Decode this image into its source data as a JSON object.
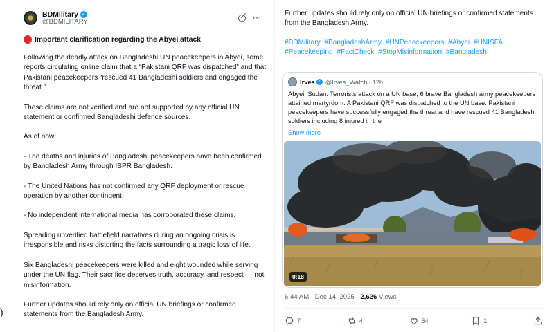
{
  "post": {
    "author": "BDMilitary",
    "handle": "@BDMILITARY",
    "headline": "Important clarification regarding the Abyei attack",
    "paragraphs": [
      "Following the deadly attack on Bangladeshi UN peacekeepers in Abyei, some reports circulating online claim that a “Pakistani QRF was dispatched” and that Pakistani peacekeepers “rescued 41 Bangladeshi soldiers and engaged the threat.”",
      "These claims are not verified and are not supported by any official UN statement or confirmed Bangladeshi defence sources.",
      "As of now:",
      "- The deaths and injuries of Bangladeshi peacekeepers have been confirmed by Bangladesh Army through ISPR Bangladesh.",
      "- The United Nations has not confirmed any QRF deployment or rescue operation by another contingent.",
      "- No independent international media has corroborated these claims.",
      "Spreading unverified battlefield narratives during an ongoing crisis is irresponsible and risks distorting the facts surrounding a tragic loss of life.",
      "Six Bangladeshi peacekeepers were killed and eight wounded while serving under the UN flag. Their sacrifice deserves truth, accuracy, and respect — not misinformation.",
      "Further updates should rely only on official UN briefings or confirmed statements from the Bangladesh Army."
    ],
    "continued_text": "Further updates should rely only on official UN briefings or confirmed statements from the Bangladesh Army.",
    "hashtags": [
      "#BDMilitary",
      "#BangladeshArmy",
      "#UNPeacekeepers",
      "#Abyei",
      "#UNISFA",
      "#Peacekeeping",
      "#FactCheck",
      "#StopMisinformation",
      "#Bangladesh"
    ],
    "timestamp": "6:44 AM · Dec 14, 2025 · ",
    "views_count": "2,626",
    "views_label": " Views",
    "actions": {
      "replies": "7",
      "reposts": "4",
      "likes": "54",
      "bookmarks": "1"
    }
  },
  "quote": {
    "author": "Irves",
    "handle": "@Irves_Watch",
    "separator": "·",
    "time": "12h",
    "text": "Abyei, Sudan: Terrorists attack on a UN base, 6 brave Bangladesh army peacekeepers attained martyrdom. A Pakistani QRF was dispatched to the UN base. Pakistani peacekeepers have successfully engaged the threat and have rescued 41 Bangladeshi soldiers including 8 injured in the",
    "show_more": "Show more",
    "video_time": "0:18"
  },
  "colors": {
    "accent": "#1d9bf0",
    "text": "#0f1419",
    "muted": "#536471",
    "alert": "#e0282f"
  },
  "icons": [
    "verified-badge-icon",
    "grok-icon",
    "more-icon",
    "alert-dot-icon",
    "reply-icon",
    "repost-icon",
    "like-icon",
    "bookmark-icon",
    "share-icon"
  ]
}
